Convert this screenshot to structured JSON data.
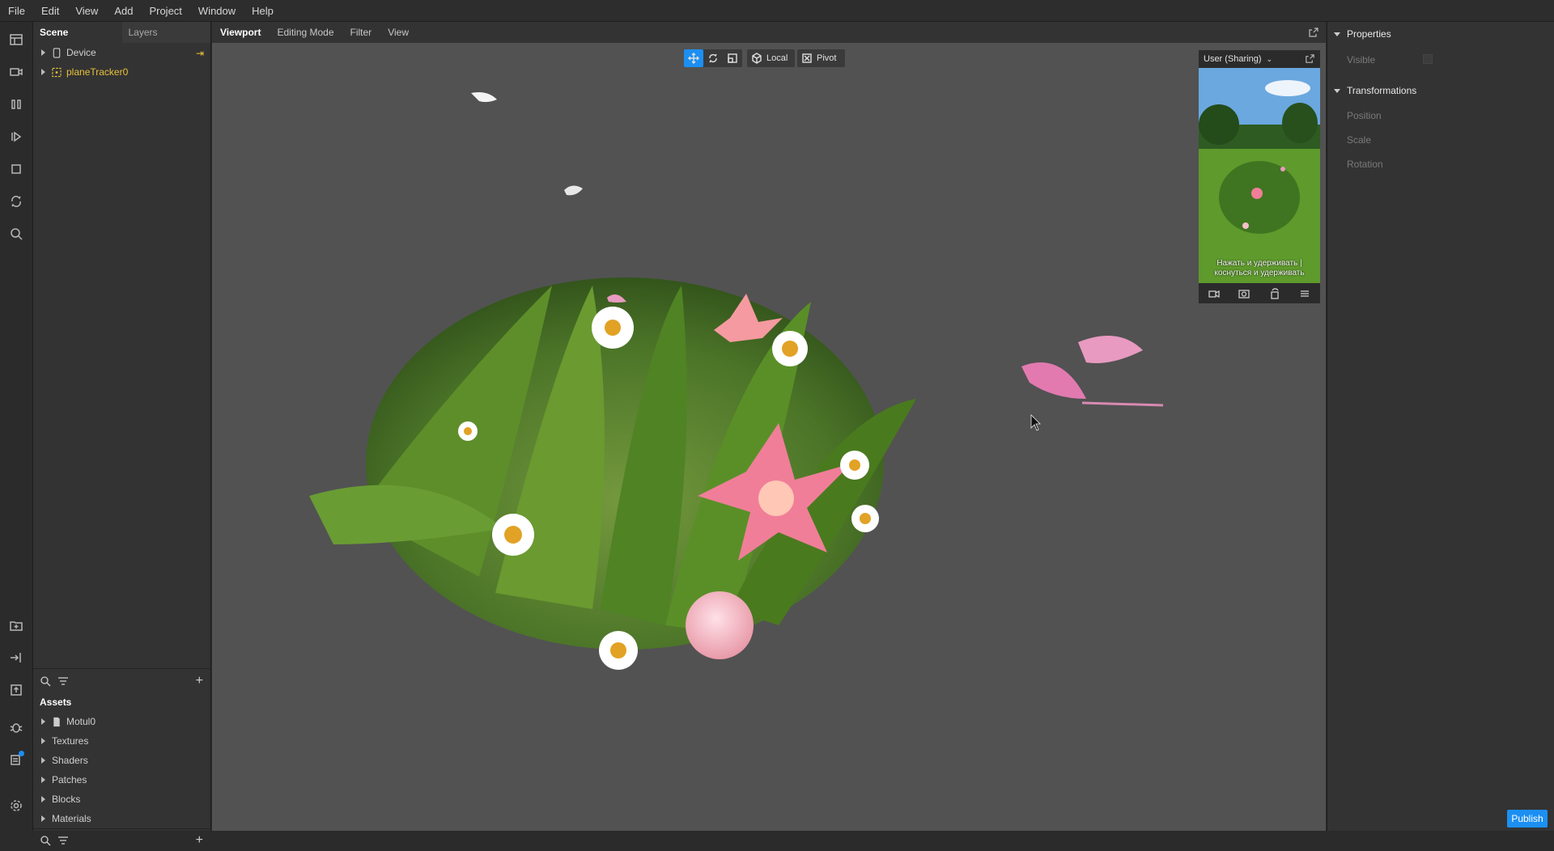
{
  "menu": [
    "File",
    "Edit",
    "View",
    "Add",
    "Project",
    "Window",
    "Help"
  ],
  "scene_panel": {
    "tab_scene": "Scene",
    "tab_layers": "Layers",
    "items": [
      {
        "label": "Device",
        "icon": "device-icon",
        "color": "#d0d0d0"
      },
      {
        "label": "planeTracker0",
        "icon": "plane-tracker-icon",
        "color": "#e8c23a"
      }
    ]
  },
  "assets_panel": {
    "title": "Assets",
    "items": [
      "Motul0",
      "Textures",
      "Shaders",
      "Patches",
      "Blocks",
      "Materials"
    ]
  },
  "viewport": {
    "tabs": [
      "Viewport",
      "Editing Mode",
      "Filter",
      "View"
    ],
    "space_label": "Local",
    "pivot_label": "Pivot"
  },
  "preview": {
    "device_label": "User (Sharing)",
    "overlay_text": "Нажать и удерживать | коснуться и удерживать"
  },
  "properties": {
    "section_properties": "Properties",
    "visible_label": "Visible",
    "section_transformations": "Transformations",
    "position_label": "Position",
    "scale_label": "Scale",
    "rotation_label": "Rotation"
  },
  "publish_label": "Publish",
  "colors": {
    "accent": "#1c8ff2",
    "tracker": "#e8c23a"
  }
}
